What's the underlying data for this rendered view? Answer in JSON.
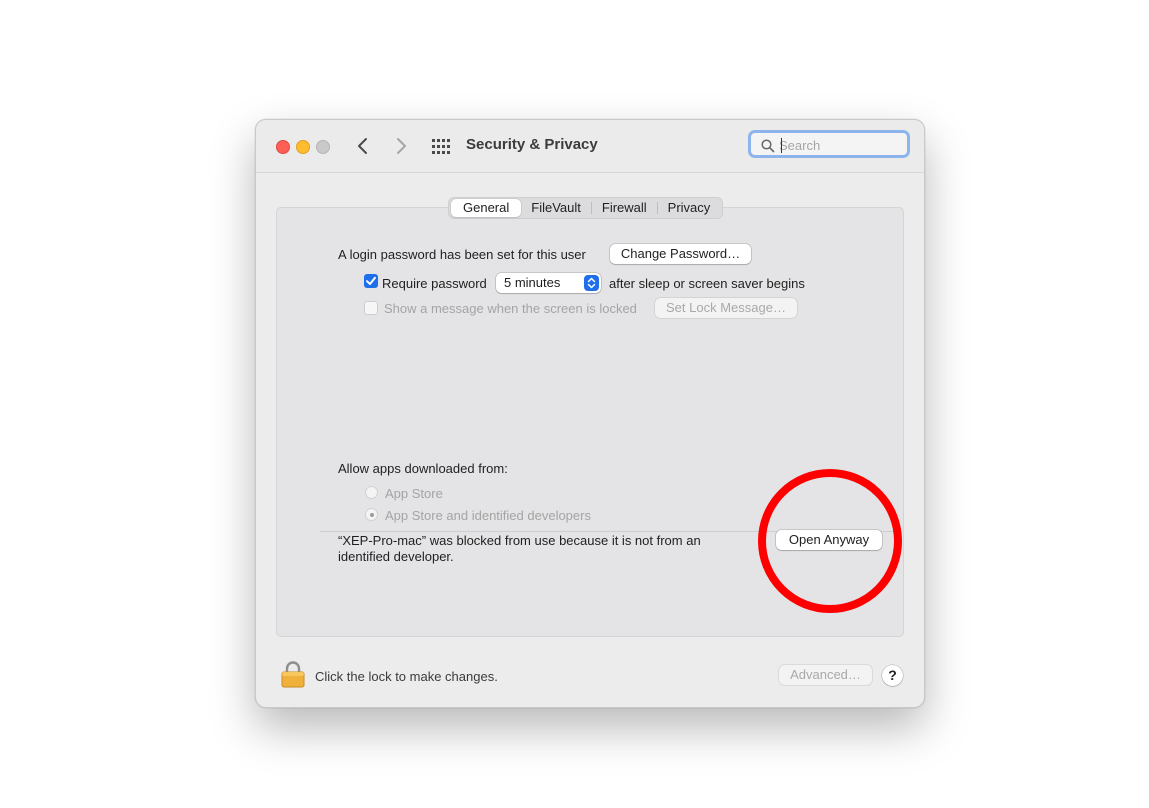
{
  "window": {
    "title": "Security & Privacy",
    "search_placeholder": "Search"
  },
  "tabs": [
    {
      "label": "General",
      "active": true
    },
    {
      "label": "FileVault",
      "active": false
    },
    {
      "label": "Firewall",
      "active": false
    },
    {
      "label": "Privacy",
      "active": false
    }
  ],
  "general": {
    "login_text": "A login password has been set for this user",
    "change_password_label": "Change Password…",
    "require_password_label": "Require password",
    "require_password_checked": true,
    "require_password_delay": "5 minutes",
    "after_sleep_text": "after sleep or screen saver begins",
    "show_message_label": "Show a message when the screen is locked",
    "show_message_checked": false,
    "set_lock_message_label": "Set Lock Message…",
    "allow_apps_label": "Allow apps downloaded from:",
    "radio_app_store": "App Store",
    "radio_identified": "App Store and identified developers",
    "radio_selected": "App Store and identified developers",
    "blocked_line1": "“XEP-Pro-mac” was blocked from use because it is not from an",
    "blocked_line2": "identified developer.",
    "open_anyway_label": "Open Anyway"
  },
  "footer": {
    "lock_text": "Click the lock to make changes.",
    "advanced_label": "Advanced…",
    "help_label": "?"
  },
  "colors": {
    "accent": "#1f6feb",
    "annotation": "#ff0000",
    "close": "#ff5f57",
    "minimize": "#febc2e"
  }
}
